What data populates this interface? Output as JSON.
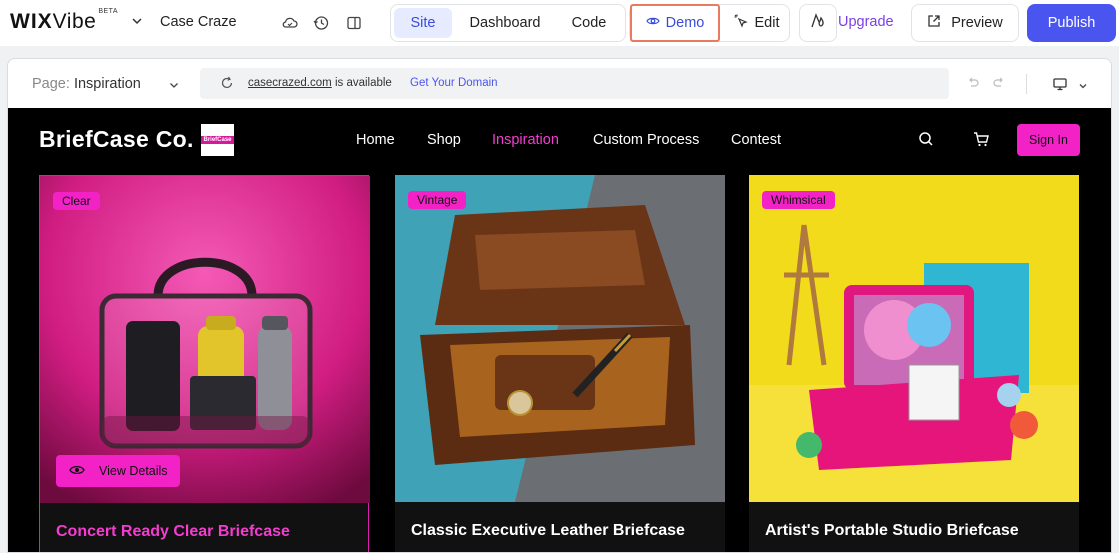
{
  "editor": {
    "logo": "WIXVibe",
    "logo_wix": "WIX",
    "logo_vibe": "Vibe",
    "logo_badge": "BETA",
    "site_name": "Case Craze",
    "modes": [
      "Site",
      "Dashboard",
      "Code"
    ],
    "active_mode": "Site",
    "demo_label": "Demo",
    "edit_label": "Edit",
    "upgrade_label": "Upgrade",
    "preview_label": "Preview",
    "publish_label": "Publish",
    "accent": "#4a55f0",
    "highlight": "#e87a5f"
  },
  "url_bar": {
    "page_prefix": "Page:",
    "page_name": "Inspiration",
    "domain": "casecrazed.com",
    "availability": "is available",
    "get_domain": "Get Your Domain"
  },
  "site": {
    "brand": "BriefCase Co.",
    "badge_text": "BriefCase",
    "nav": [
      "Home",
      "Shop",
      "Inspiration",
      "Custom Process",
      "Contest"
    ],
    "active_nav": "Inspiration",
    "sign_in": "Sign In",
    "brand_color": "#f222c7",
    "cards": [
      {
        "tag": "Clear",
        "title": "Concert Ready Clear Briefcase",
        "view_details": "View Details"
      },
      {
        "tag": "Vintage",
        "title": "Classic Executive Leather Briefcase"
      },
      {
        "tag": "Whimsical",
        "title": "Artist's Portable Studio Briefcase"
      }
    ]
  }
}
